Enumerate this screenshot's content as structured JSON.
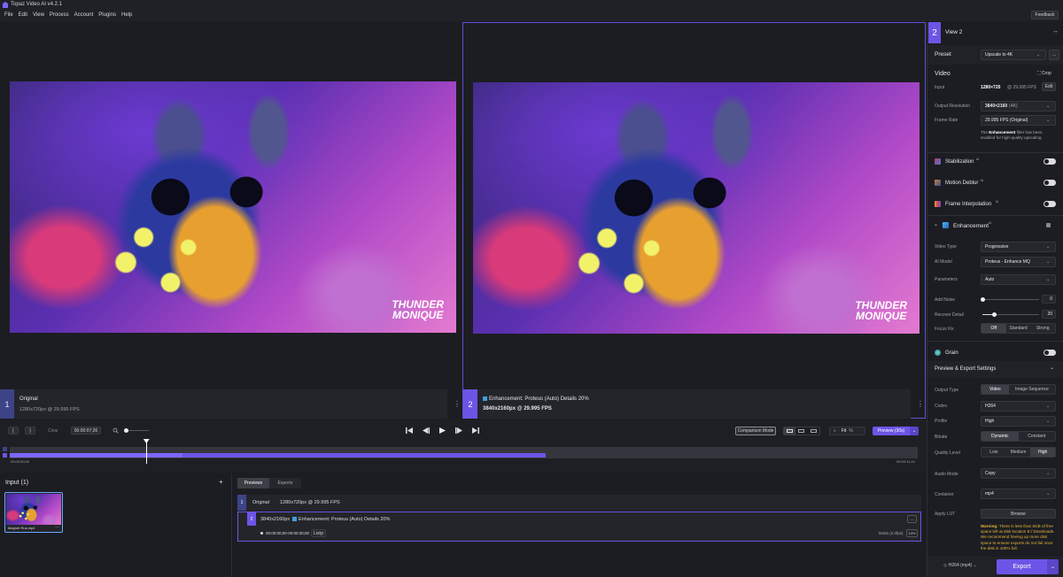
{
  "app": {
    "title": "Topaz Video AI  v4.2.1",
    "feedback": "Feedback"
  },
  "menu": [
    "File",
    "Edit",
    "View",
    "Process",
    "Account",
    "Plugins",
    "Help"
  ],
  "views": [
    {
      "num": "1",
      "title": "Original",
      "sub": "1280x720px @ 29.995 FPS",
      "watermark_l1": "THUNDER",
      "watermark_l2": "MONIQUE"
    },
    {
      "num": "2",
      "title": "Enhancement: Proteus (Auto) Details 20%",
      "sub": "3840x2160px @ 29.995 FPS",
      "watermark_l1": "THUNDER",
      "watermark_l2": "MONIQUE"
    }
  ],
  "timeline": {
    "in": "[",
    "out": "]",
    "clear": "Clear",
    "time": "00:00:07;26",
    "comparison": "Comparison Mode",
    "fit": "Fit",
    "preview": "Preview (30s)",
    "start": "00:00:00;00",
    "end": "00:00:11;10"
  },
  "input": {
    "title": "Input (1)",
    "file": "Magnet Rus.mp4",
    "add": "+"
  },
  "previews": {
    "tabs": [
      "Previews",
      "Exports"
    ],
    "row1": {
      "num": "1",
      "label": "Original",
      "sub": "1280x720px @ 29.995 FPS"
    },
    "row2": {
      "num": "2",
      "res": "3840x2160px",
      "label": "Enhancement: Proteus (Auto) Details 20%",
      "range": "00:00:00;00-00:00:30;00",
      "loop": "Loop",
      "meta": "5m5s (2.0fps)",
      "pct": "10%"
    }
  },
  "panel": {
    "view_num": "2",
    "view_title": "View 2",
    "preset_label": "Preset",
    "preset_value": "Upscale to 4K",
    "video_title": "Video",
    "crop": "Crop",
    "input_label": "Input",
    "input_value": "1280×720",
    "input_fps": "@ 29.995 FPS",
    "edit": "Edit",
    "outres_label": "Output Resolution",
    "outres_value": "3840×2160",
    "outres_tag": "(4K)",
    "framerate_label": "Frame Rate",
    "framerate_value": "29.995 FPS (Original)",
    "note_pre": "The ",
    "note_bold": "Enhancement",
    "note_post": " filter has been enabled for high-quality upscaling.",
    "stabilization": "Stabilization",
    "motion_deblur": "Motion Deblur",
    "frame_interp": "Frame Interpolation",
    "enhancement": "Enhancement",
    "ai": "AI",
    "vtype_label": "Video Type",
    "vtype_value": "Progressive",
    "model_label": "AI Model",
    "model_value": "Proteus - Enhance MQ",
    "params_label": "Parameters",
    "params_value": "Auto",
    "noise_label": "Add Noise",
    "noise_value": "0",
    "detail_label": "Recover Detail",
    "detail_value": "20",
    "focus_label": "Focus Fix",
    "focus_opts": [
      "Off",
      "Standard",
      "Strong"
    ],
    "grain": "Grain",
    "export_title": "Preview & Export Settings",
    "otype_label": "Output Type",
    "otype_opts": [
      "Video",
      "Image Sequence"
    ],
    "codec_label": "Codec",
    "codec_value": "H264",
    "profile_label": "Profile",
    "profile_value": "High",
    "bitrate_label": "Bitrate",
    "bitrate_opts": [
      "Dynamic",
      "Constant"
    ],
    "quality_label": "Quality Level",
    "quality_opts": [
      "Low",
      "Medium",
      "High"
    ],
    "audio_label": "Audio Mode",
    "audio_value": "Copy",
    "container_label": "Container",
    "container_value": "mp4",
    "lut_label": "Apply LUT",
    "browse": "Browse",
    "warning_bold": "Warning:",
    "warning_text": " There is less than 5GB of free space left at disk location E:/ Downloads. We recommend freeing up more disk space to ensure exports do not fail once the disk is 100% full.",
    "format": "H264 (mp4)",
    "export": "Export"
  },
  "colors": {
    "accent": "#6c55e6",
    "warning": "#e7b53c"
  },
  "video_progress": {
    "playhead_percent": 15,
    "range_percent": 59
  }
}
